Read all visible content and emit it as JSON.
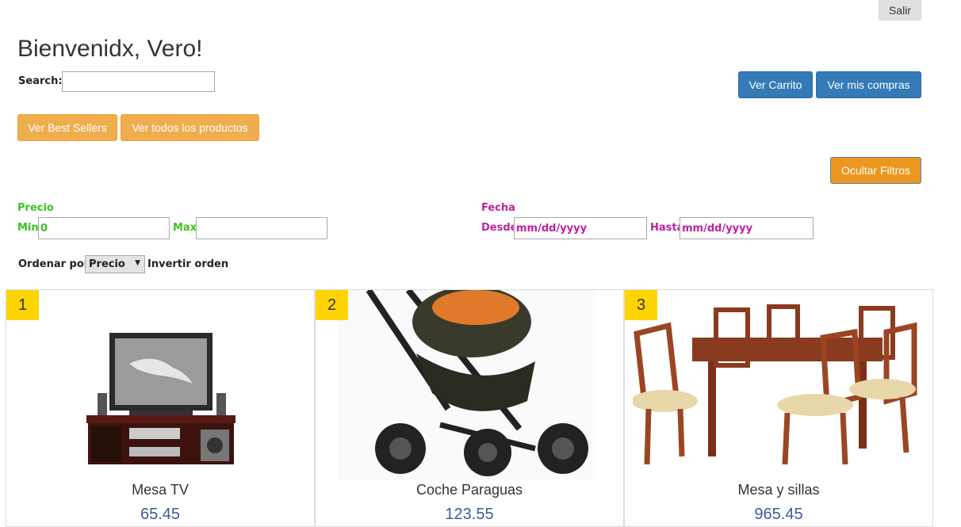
{
  "header": {
    "logout_label": "Salir",
    "welcome": "Bienvenidx, Vero!",
    "search_label": "Search:",
    "search_value": "",
    "cart_label": "Ver Carrito",
    "purchases_label": "Ver mis compras",
    "best_sellers_label": "Ver Best Sellers",
    "all_products_label": "Ver todos los productos",
    "hide_filters_label": "Ocultar Filtros"
  },
  "filters": {
    "price": {
      "title": "Precio",
      "min_label": "Min",
      "min_value": "0",
      "max_label": "Max",
      "max_value": ""
    },
    "date": {
      "title": "Fecha",
      "from_label": "Desde",
      "from_value": "mm/dd/yyyy",
      "to_label": "Hasta",
      "to_value": "mm/dd/yyyy"
    },
    "sort": {
      "label": "Ordenar por",
      "selected": "Precio",
      "invert_label": "Invertir orden"
    }
  },
  "colors": {
    "price_filter": "#3ac41f",
    "date_filter": "#c21fa1",
    "badge": "#ffd400",
    "primary": "#337ab7",
    "warning": "#f0ad4e"
  },
  "products": [
    {
      "rank": "1",
      "name": "Mesa TV",
      "price": "65.45",
      "icon": "tv-stand-image"
    },
    {
      "rank": "2",
      "name": "Coche Paraguas",
      "price": "123.55",
      "icon": "stroller-image"
    },
    {
      "rank": "3",
      "name": "Mesa y sillas",
      "price": "965.45",
      "icon": "dining-set-image"
    }
  ]
}
